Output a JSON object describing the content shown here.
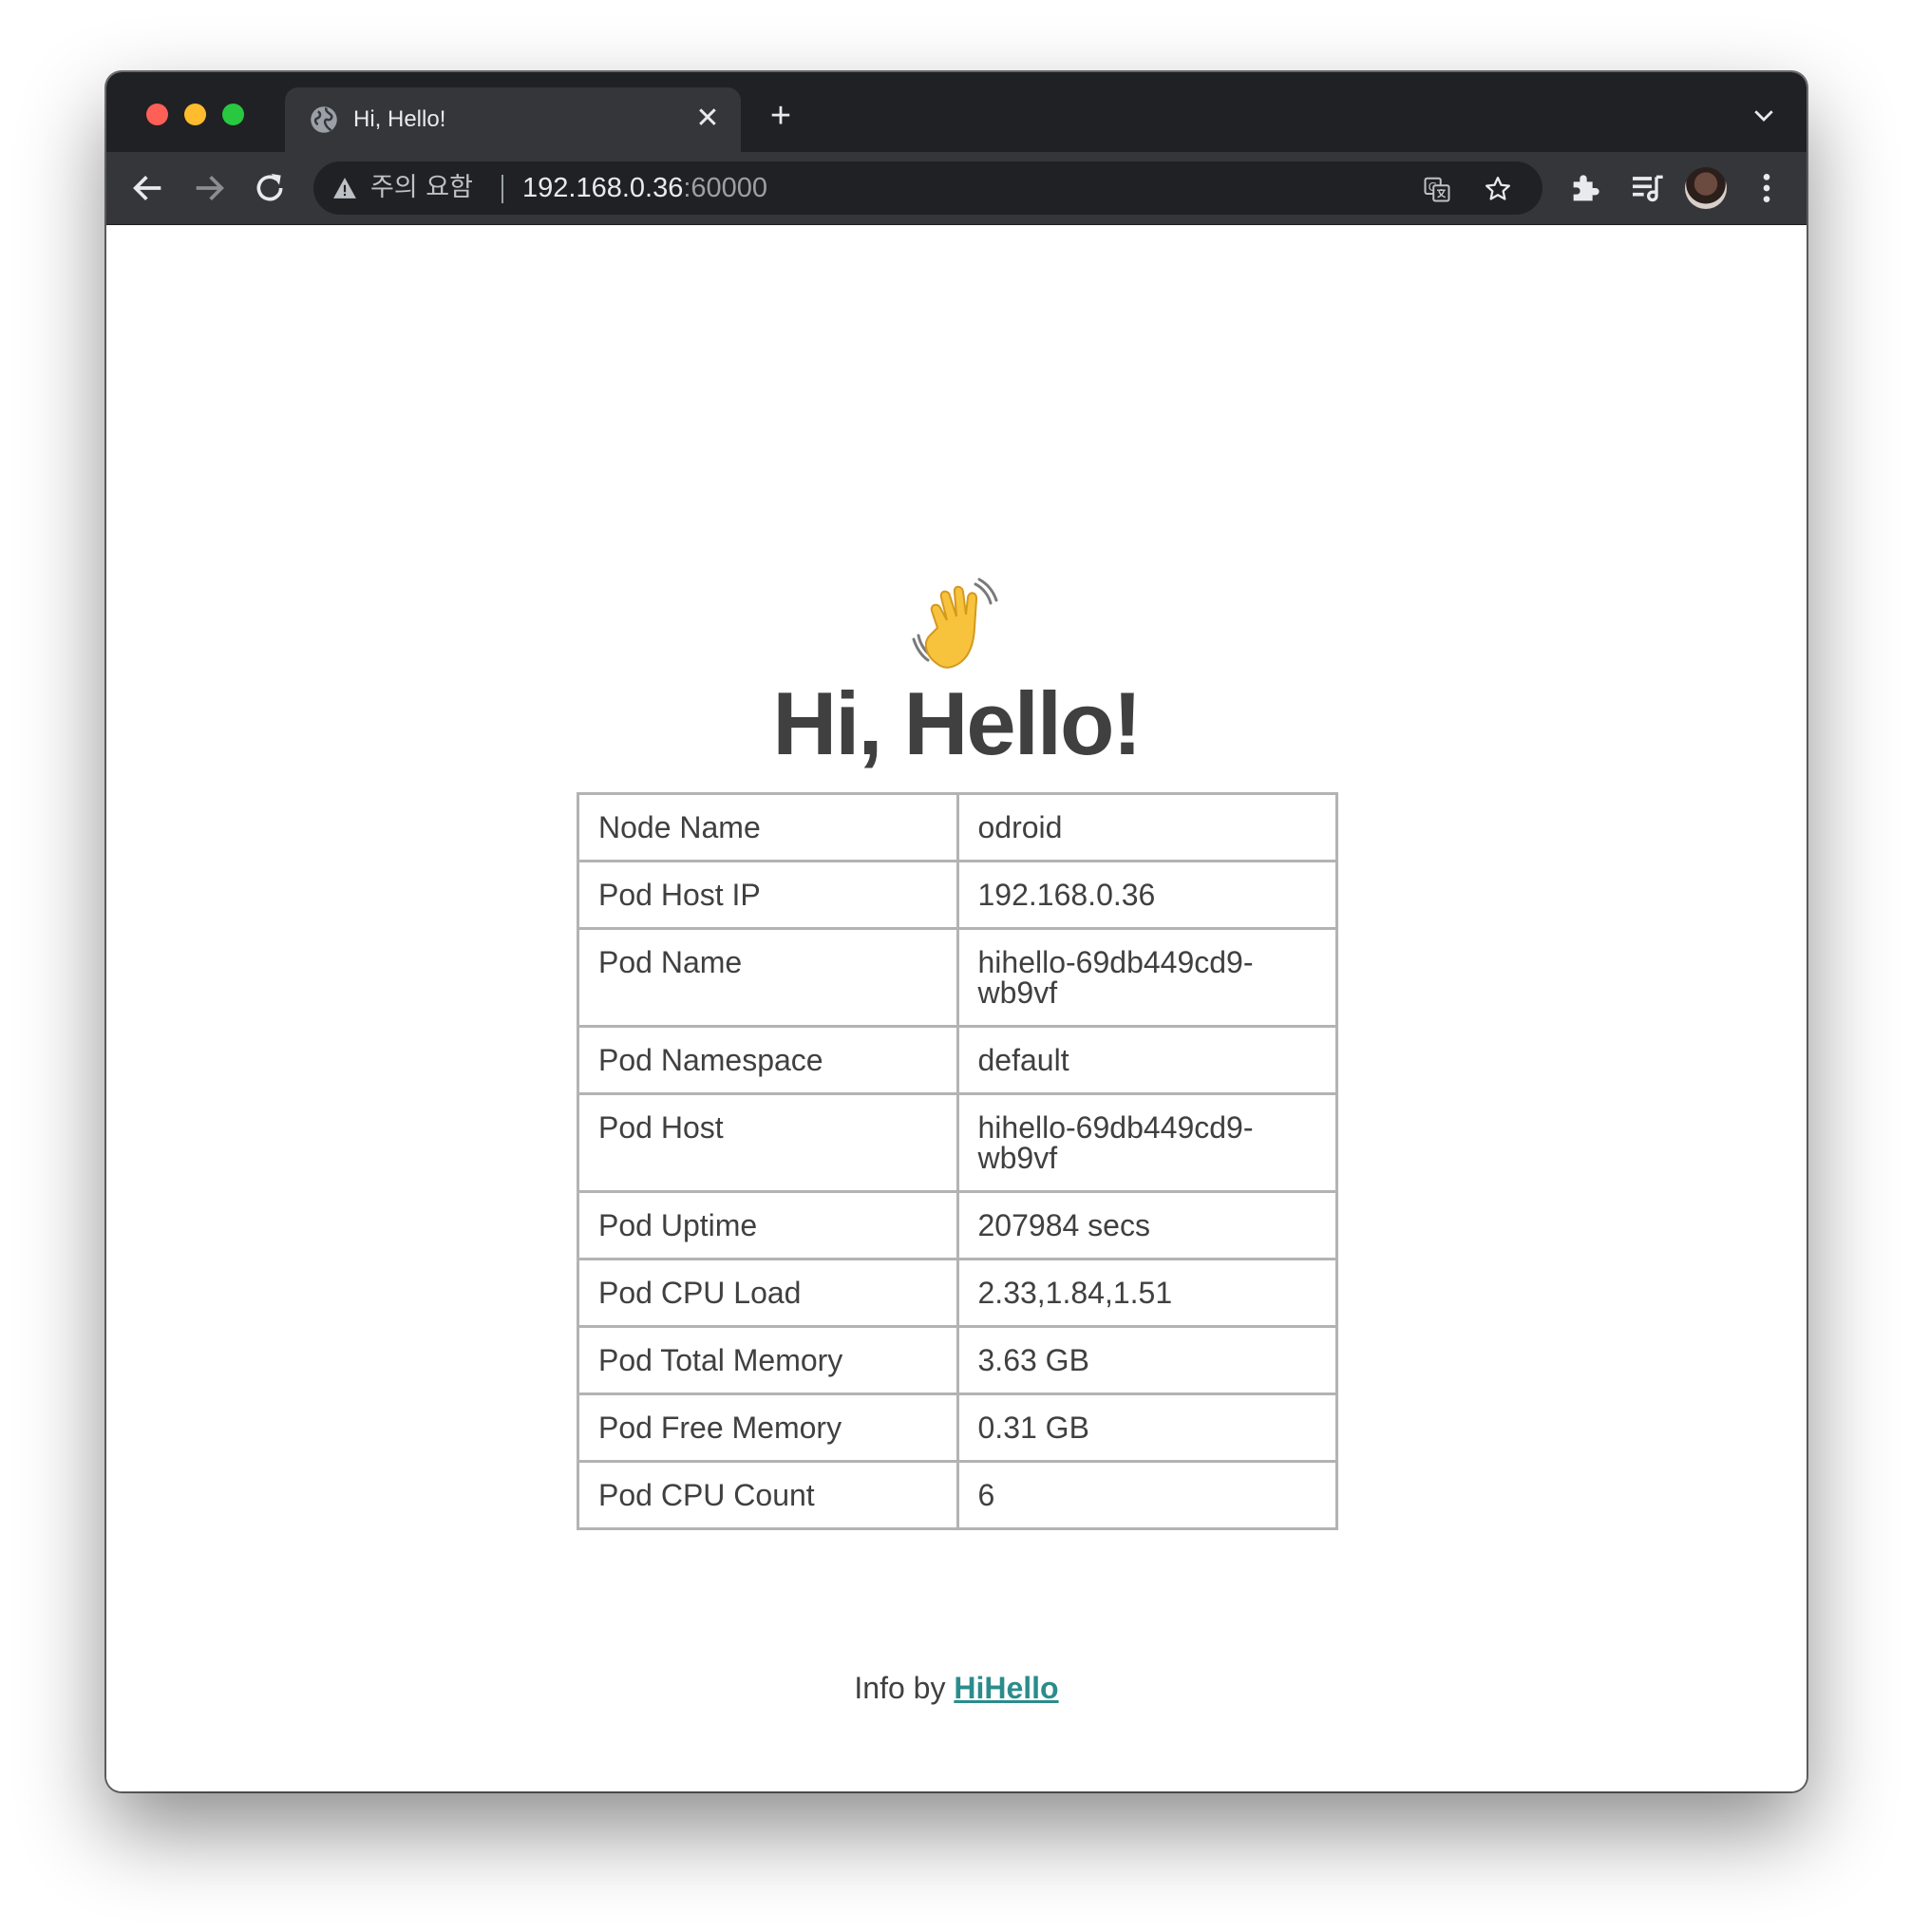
{
  "browser": {
    "tab": {
      "title": "Hi, Hello!"
    },
    "address": {
      "security_label": "주의 요함",
      "host": "192.168.0.36",
      "port": ":60000"
    }
  },
  "page": {
    "emoji": "waving-hand",
    "heading": "Hi, Hello!",
    "rows": [
      {
        "label": "Node Name",
        "value": "odroid"
      },
      {
        "label": "Pod Host IP",
        "value": "192.168.0.36"
      },
      {
        "label": "Pod Name",
        "value": "hihello-69db449cd9-wb9vf"
      },
      {
        "label": "Pod Namespace",
        "value": "default"
      },
      {
        "label": "Pod Host",
        "value": "hihello-69db449cd9-wb9vf"
      },
      {
        "label": "Pod Uptime",
        "value": "207984 secs"
      },
      {
        "label": "Pod CPU Load",
        "value": "2.33,1.84,1.51"
      },
      {
        "label": "Pod Total Memory",
        "value": "3.63 GB"
      },
      {
        "label": "Pod Free Memory",
        "value": "0.31 GB"
      },
      {
        "label": "Pod CPU Count",
        "value": "6"
      }
    ],
    "footer": {
      "prefix": "Info by ",
      "link": "HiHello"
    }
  },
  "colors": {
    "titlebar": "#202124",
    "toolbar": "#35363a",
    "text": "#404040",
    "link": "#2b8c8c",
    "border": "#b3b3b3"
  }
}
